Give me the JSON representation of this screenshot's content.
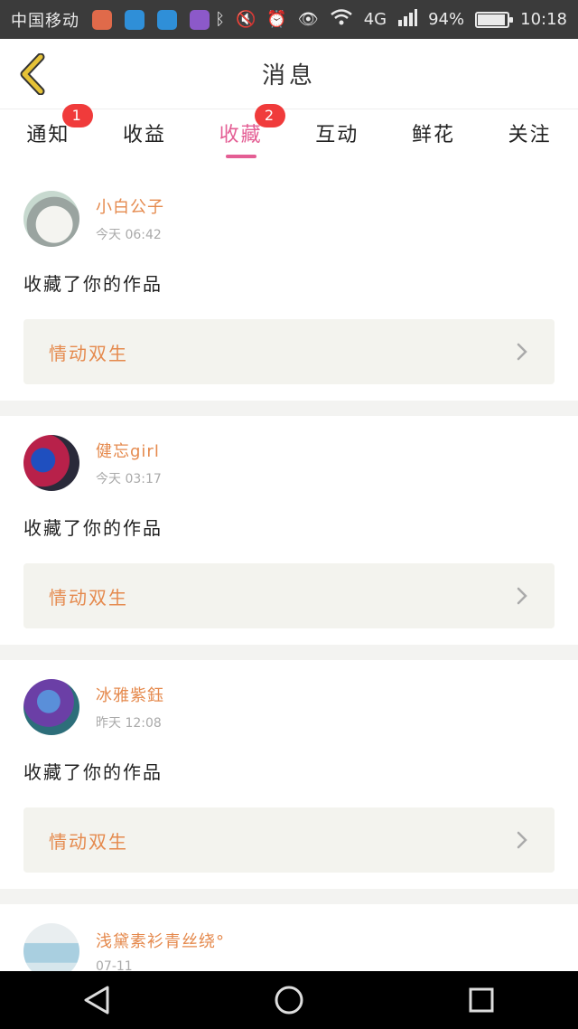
{
  "status_bar": {
    "carrier": "中国移动",
    "network": "4G",
    "battery_text": "94%",
    "battery_level": 0.94,
    "time": "10:18",
    "app_icons": [
      {
        "name": "mail-app-icon",
        "color": "#e06a4a"
      },
      {
        "name": "video-app-icon",
        "color": "#2f8fd8"
      },
      {
        "name": "video-app-icon-2",
        "color": "#2f8fd8"
      },
      {
        "name": "chat-app-icon",
        "color": "#8c59c9"
      }
    ]
  },
  "header": {
    "title": "消息",
    "back_icon": "back-chevron-icon",
    "back_color": "#e5c237"
  },
  "tabs": [
    {
      "label": "通知",
      "badge": "1",
      "active": false
    },
    {
      "label": "收益",
      "badge": "",
      "active": false
    },
    {
      "label": "收藏",
      "badge": "2",
      "active": true
    },
    {
      "label": "互动",
      "badge": "",
      "active": false
    },
    {
      "label": "鲜花",
      "badge": "",
      "active": false
    },
    {
      "label": "关注",
      "badge": "",
      "active": false
    }
  ],
  "colors": {
    "accent": "#e45e94",
    "username": "#e58a4e",
    "badge": "#f03b3b",
    "card_bg": "#f3f3ee"
  },
  "feed": [
    {
      "username": "小白公子",
      "time": "今天 06:42",
      "action": "收藏了你的作品",
      "work": "情动双生",
      "avatar_style": "cat"
    },
    {
      "username": "健忘girl",
      "time": "今天 03:17",
      "action": "收藏了你的作品",
      "work": "情动双生",
      "avatar_style": "stars"
    },
    {
      "username": "冰雅紫鈺",
      "time": "昨天 12:08",
      "action": "收藏了你的作品",
      "work": "情动双生",
      "avatar_style": "anime"
    },
    {
      "username": "浅黛素衫青丝绕°",
      "time": "07-11",
      "action": "",
      "work": "",
      "avatar_style": "sky"
    }
  ],
  "nav_bar": {
    "back_icon": "nav-back-icon",
    "home_icon": "nav-home-icon",
    "recents_icon": "nav-recents-icon"
  }
}
